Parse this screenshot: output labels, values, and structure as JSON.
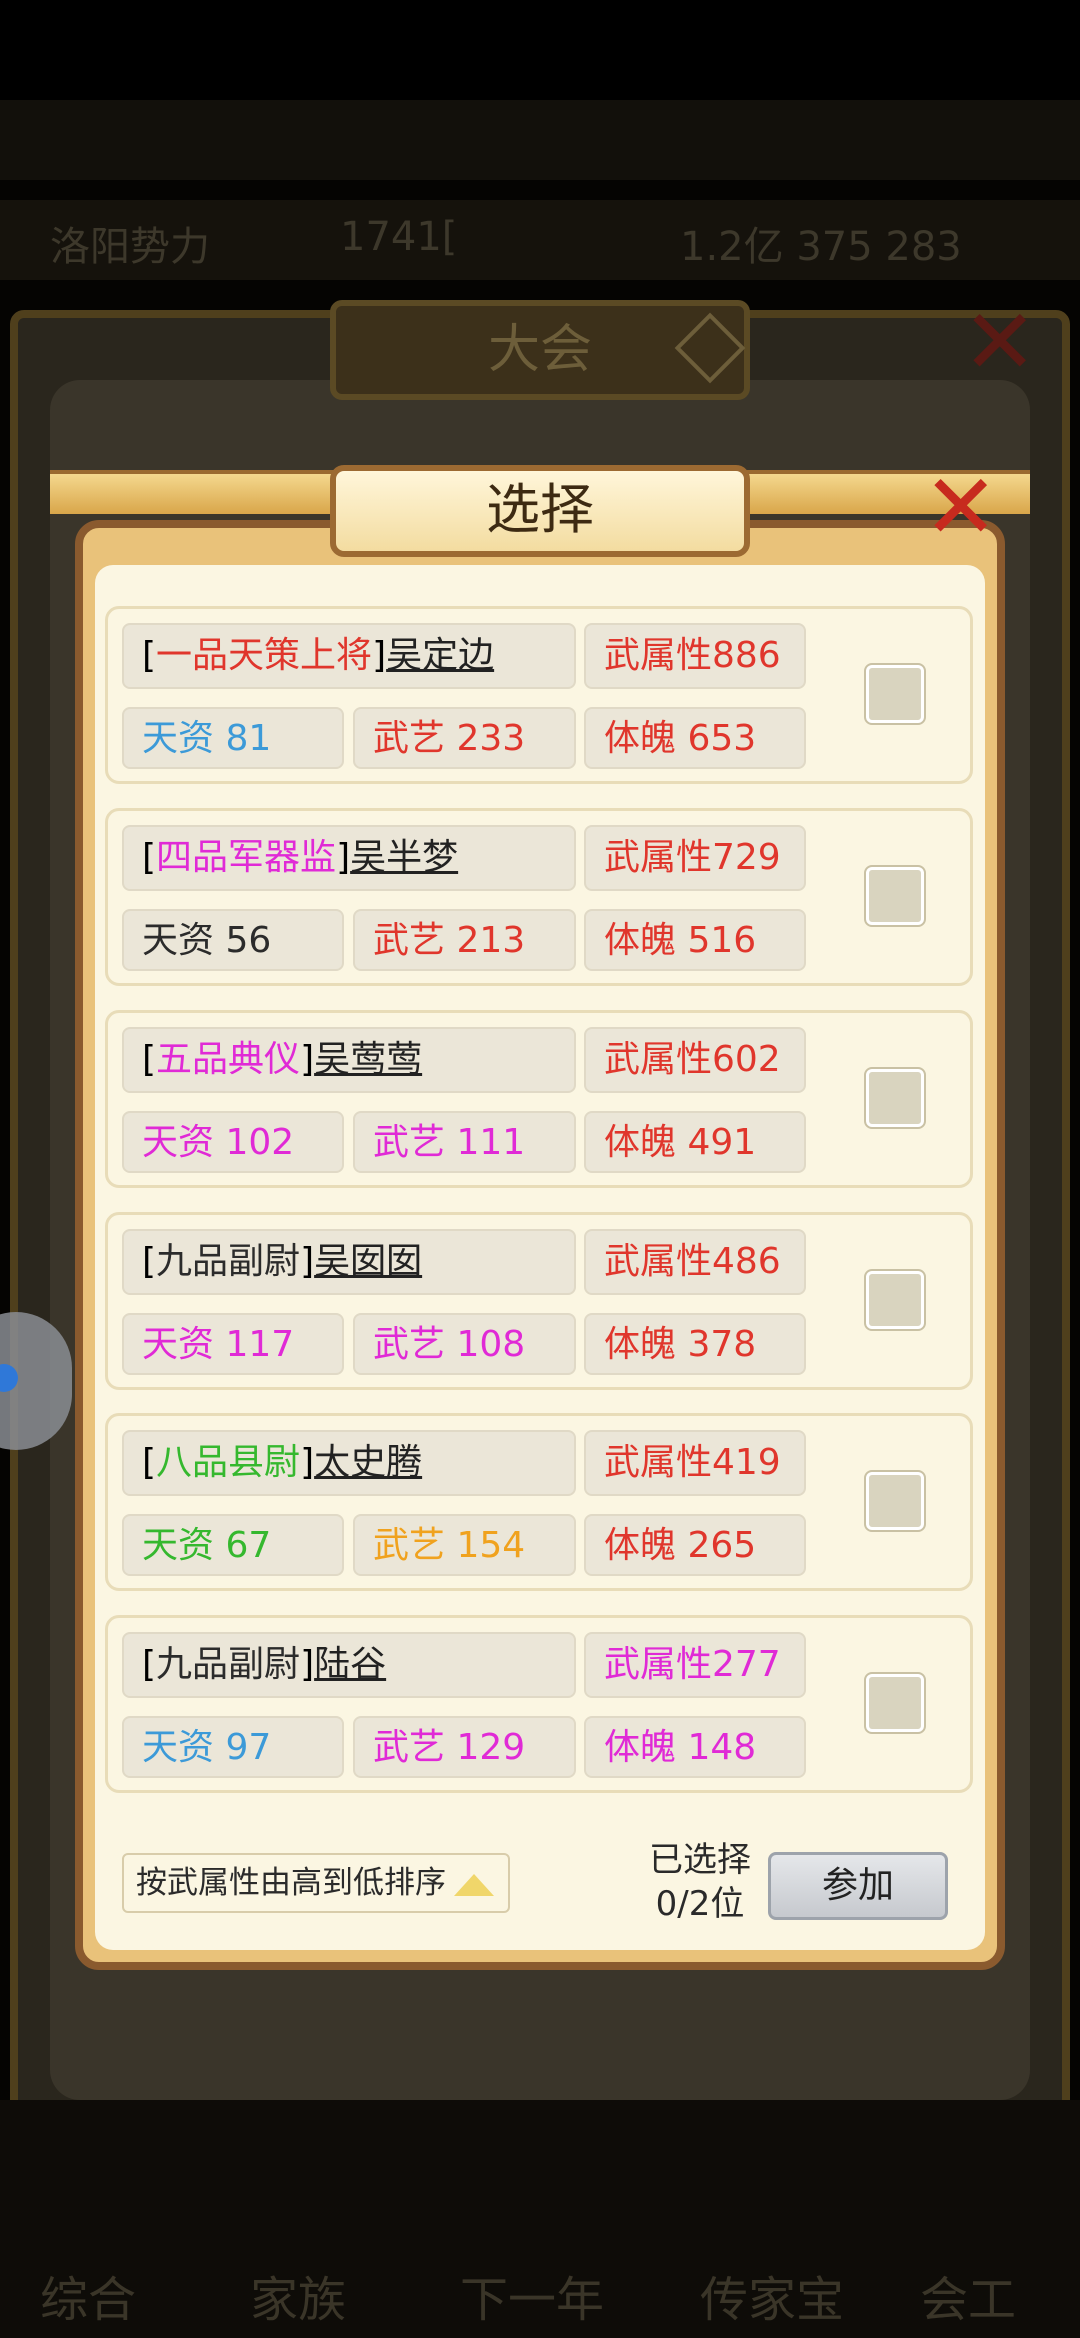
{
  "background": {
    "top_bar_left": "洛阳势力",
    "top_bar_mid": "1741[",
    "top_bar_right": "1.2亿 375 283"
  },
  "outer_dialog": {
    "title": "大会"
  },
  "dialog": {
    "title": "选择",
    "close": "✕"
  },
  "candidates": [
    {
      "rank": "一品天策上将",
      "rank_color": "#e0362c",
      "name": "吴定边",
      "attr": "武属性886",
      "attr_color": "#e0362c",
      "tianzi": "天资 81",
      "tianzi_color": "#3c9ad8",
      "wuyi": "武艺 233",
      "wuyi_color": "#e0362c",
      "tipo": "体魄 653",
      "tipo_color": "#e0362c"
    },
    {
      "rank": "四品军器监",
      "rank_color": "#e02ad6",
      "name": "吴半梦",
      "attr": "武属性729",
      "attr_color": "#e0362c",
      "tianzi": "天资 56",
      "tianzi_color": "#2b2b2b",
      "wuyi": "武艺 213",
      "wuyi_color": "#e0362c",
      "tipo": "体魄 516",
      "tipo_color": "#e0362c"
    },
    {
      "rank": "五品典仪",
      "rank_color": "#e02ad6",
      "name": "吴莺莺",
      "attr": "武属性602",
      "attr_color": "#e0362c",
      "tianzi": "天资 102",
      "tianzi_color": "#e02ad6",
      "wuyi": "武艺 111",
      "wuyi_color": "#e02ad6",
      "tipo": "体魄 491",
      "tipo_color": "#e0362c"
    },
    {
      "rank": "九品副尉",
      "rank_color": "#2b2b2b",
      "name": "吴囡囡",
      "attr": "武属性486",
      "attr_color": "#e0362c",
      "tianzi": "天资 117",
      "tianzi_color": "#e02ad6",
      "wuyi": "武艺 108",
      "wuyi_color": "#e02ad6",
      "tipo": "体魄 378",
      "tipo_color": "#e0362c"
    },
    {
      "rank": "八品县尉",
      "rank_color": "#35b82e",
      "name": "太史腾",
      "attr": "武属性419",
      "attr_color": "#e0362c",
      "tianzi": "天资 67",
      "tianzi_color": "#35b82e",
      "wuyi": "武艺 154",
      "wuyi_color": "#f0a21e",
      "tipo": "体魄 265",
      "tipo_color": "#e0362c"
    },
    {
      "rank": "九品副尉",
      "rank_color": "#2b2b2b",
      "name": "陆谷",
      "attr": "武属性277",
      "attr_color": "#e02ad6",
      "tianzi": "天资 97",
      "tianzi_color": "#3c9ad8",
      "wuyi": "武艺 129",
      "wuyi_color": "#e02ad6",
      "tipo": "体魄 148",
      "tipo_color": "#e02ad6"
    }
  ],
  "footer": {
    "sort_label": "按武属性由高到低排序",
    "selected_line1": "已选择",
    "selected_line2": "0/2位",
    "join_label": "参加"
  },
  "bottom_nav": [
    "综合",
    "家族",
    "下一年",
    "传家宝",
    "会工"
  ]
}
